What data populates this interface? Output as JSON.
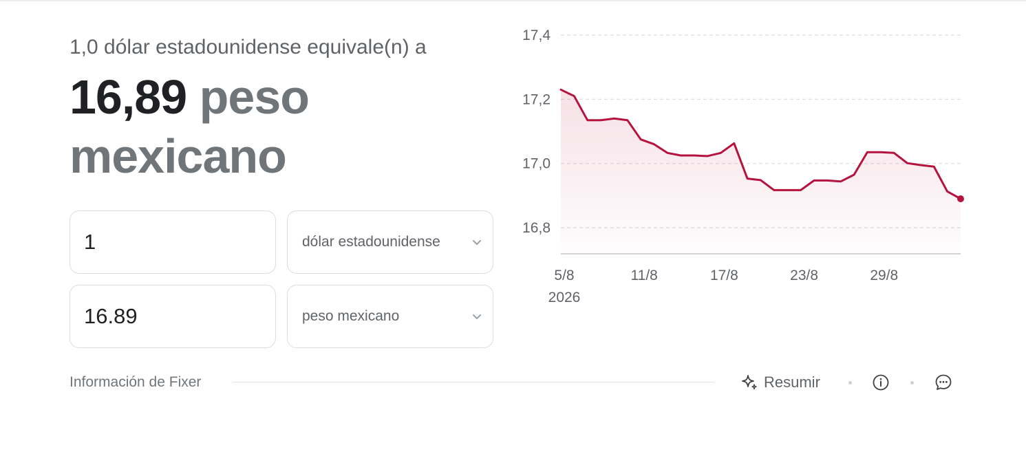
{
  "header": {
    "subtitle": "1,0 dólar estadounidense equivale(n) a",
    "result_value": "16,89",
    "result_currency": "peso mexicano"
  },
  "converter": {
    "amount_value": "1",
    "from_currency": "dólar estadounidense",
    "converted_value": "16.89",
    "to_currency": "peso mexicano"
  },
  "footer": {
    "source": "Información de Fixer",
    "summarize_label": "Resumir",
    "icons": [
      "sparkle-icon",
      "info-icon",
      "feedback-icon"
    ]
  },
  "colors": {
    "series": "#b5123e",
    "grid": "#dadce0",
    "text_muted": "#70757a"
  },
  "chart_data": {
    "type": "area",
    "y_ticks": [
      "17,4",
      "17,2",
      "17,0",
      "16,8"
    ],
    "y_tick_values": [
      17.4,
      17.2,
      17.0,
      16.8
    ],
    "x_ticks": [
      "5/8",
      "11/8",
      "17/8",
      "23/8",
      "29/8"
    ],
    "x_tick_day_index": [
      0,
      6,
      12,
      18,
      24
    ],
    "x_year_label": "2026",
    "ylim": [
      16.72,
      17.43
    ],
    "grid": "horizontal dashed",
    "series": [
      {
        "values": [
          17.23,
          17.21,
          17.135,
          17.135,
          17.14,
          17.135,
          17.075,
          17.06,
          17.033,
          17.025,
          17.025,
          17.023,
          17.033,
          17.063,
          16.953,
          16.948,
          16.917,
          16.917,
          16.917,
          16.947,
          16.947,
          16.944,
          16.965,
          17.035,
          17.035,
          17.033,
          17.001,
          16.995,
          16.99,
          16.913,
          16.89
        ]
      }
    ]
  }
}
